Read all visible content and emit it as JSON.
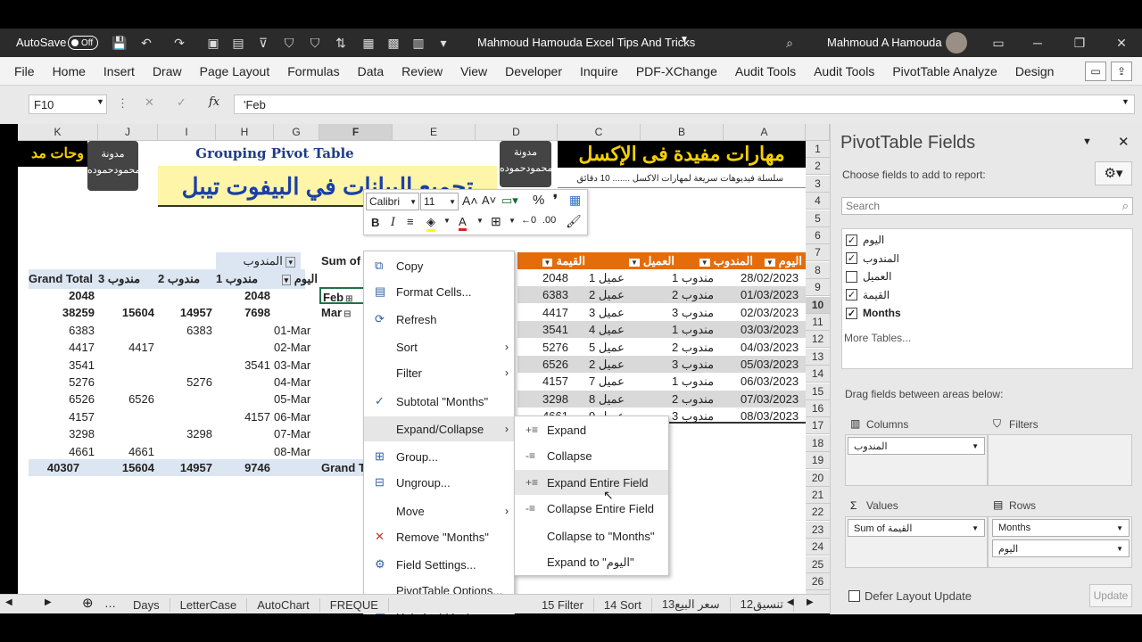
{
  "titlebar": {
    "autosave": "AutoSave",
    "toggle": "Off",
    "doc_title": "Mahmoud Hamouda Excel Tips And Tricks",
    "user": "Mahmoud A Hamouda"
  },
  "menu": [
    "File",
    "Home",
    "Insert",
    "Draw",
    "Page Layout",
    "Formulas",
    "Data",
    "Review",
    "View",
    "Developer",
    "Inquire",
    "PDF-XChange",
    "Audit Tools",
    "Audit Tools",
    "PivotTable Analyze",
    "Design"
  ],
  "formula": {
    "namebox": "F10",
    "cancel": "✕",
    "enter": "✓",
    "fx": "fx",
    "value": "'Feb"
  },
  "columns": [
    "K",
    "J",
    "I",
    "H",
    "G",
    "F",
    "E",
    "D",
    "C",
    "B",
    "A"
  ],
  "rows": [
    "1",
    "2",
    "3",
    "4",
    "5",
    "6",
    "7",
    "8",
    "9",
    "10",
    "11",
    "12",
    "13",
    "14",
    "15",
    "16",
    "17",
    "18",
    "19",
    "20",
    "21",
    "22",
    "23",
    "24",
    "25",
    "26",
    "27"
  ],
  "banner": {
    "left_top": "وحات مد",
    "logo1": "مدونة محمودحموده",
    "pivot_en": "Grouping Pivot Table",
    "pivot_ar": "تجميع البيانات في البيفوت تيبل",
    "logo2": "مدونة محمودحموده",
    "right_title": "مهارات مفيدة فى الإكسل",
    "right_sub": "سلسلة فيديوهات سريعة لمهارات الاكسل ....... 10 دقائق"
  },
  "pivot": {
    "sum_label": "Sum of",
    "col_field": "المندوب",
    "headers": [
      "Grand Total",
      "مندوب 3",
      "مندوب 2",
      "مندوب 1",
      "اليوم"
    ],
    "rows": [
      {
        "label": "",
        "gt": "2048",
        "m3": "",
        "m2": "",
        "m1": "2048",
        "bold": true,
        "f": "Feb"
      },
      {
        "label": "",
        "gt": "38259",
        "m3": "15604",
        "m2": "14957",
        "m1": "7698",
        "bold": true,
        "f": "Mar"
      },
      {
        "label": "01-Mar",
        "gt": "6383",
        "m3": "",
        "m2": "6383",
        "m1": "",
        "bold": false,
        "f": ""
      },
      {
        "label": "02-Mar",
        "gt": "4417",
        "m3": "4417",
        "m2": "",
        "m1": "",
        "bold": false,
        "f": ""
      },
      {
        "label": "03-Mar",
        "gt": "3541",
        "m3": "",
        "m2": "",
        "m1": "3541",
        "bold": false,
        "f": ""
      },
      {
        "label": "04-Mar",
        "gt": "5276",
        "m3": "",
        "m2": "5276",
        "m1": "",
        "bold": false,
        "f": ""
      },
      {
        "label": "05-Mar",
        "gt": "6526",
        "m3": "6526",
        "m2": "",
        "m1": "",
        "bold": false,
        "f": ""
      },
      {
        "label": "06-Mar",
        "gt": "4157",
        "m3": "",
        "m2": "",
        "m1": "4157",
        "bold": false,
        "f": ""
      },
      {
        "label": "07-Mar",
        "gt": "3298",
        "m3": "",
        "m2": "3298",
        "m1": "",
        "bold": false,
        "f": ""
      },
      {
        "label": "08-Mar",
        "gt": "4661",
        "m3": "4661",
        "m2": "",
        "m1": "",
        "bold": false,
        "f": ""
      }
    ],
    "total": {
      "gt": "40307",
      "m3": "15604",
      "m2": "14957",
      "m1": "9746",
      "label": "Grand T"
    },
    "mo_label": "Mo"
  },
  "table": {
    "headers": [
      "القيمة",
      "العميل",
      "المندوب",
      "اليوم"
    ],
    "rows": [
      [
        "2048",
        "عميل 1",
        "مندوب 1",
        "28/02/2023"
      ],
      [
        "6383",
        "عميل 2",
        "مندوب 2",
        "01/03/2023"
      ],
      [
        "4417",
        "عميل 3",
        "مندوب 3",
        "02/03/2023"
      ],
      [
        "3541",
        "عميل 4",
        "مندوب 1",
        "03/03/2023"
      ],
      [
        "5276",
        "عميل 5",
        "مندوب 2",
        "04/03/2023"
      ],
      [
        "6526",
        "عميل 2",
        "مندوب 3",
        "05/03/2023"
      ],
      [
        "4157",
        "عميل 7",
        "مندوب 1",
        "06/03/2023"
      ],
      [
        "3298",
        "عميل 8",
        "مندوب 2",
        "07/03/2023"
      ],
      [
        "4661",
        "عميل 9",
        "مندوب 3",
        "08/03/2023"
      ]
    ]
  },
  "mini_toolbar": {
    "font": "Calibri",
    "size": "11"
  },
  "context_menu": [
    {
      "label": "Copy",
      "icon": "copy-icon",
      "glyph": "⧉",
      "arrow": false
    },
    {
      "label": "Format Cells...",
      "icon": "format-cells-icon",
      "glyph": "▤",
      "arrow": false
    },
    {
      "label": "Refresh",
      "icon": "refresh-icon",
      "glyph": "⟳",
      "arrow": false
    },
    {
      "label": "Sort",
      "icon": "",
      "glyph": "",
      "arrow": true
    },
    {
      "label": "Filter",
      "icon": "",
      "glyph": "",
      "arrow": true
    },
    {
      "label": "Subtotal \"Months\"",
      "icon": "check-icon",
      "glyph": "✓",
      "arrow": false
    },
    {
      "label": "Expand/Collapse",
      "icon": "",
      "glyph": "",
      "arrow": true
    },
    {
      "label": "Group...",
      "icon": "group-icon",
      "glyph": "⊞",
      "arrow": false
    },
    {
      "label": "Ungroup...",
      "icon": "ungroup-icon",
      "glyph": "⊟",
      "arrow": false
    },
    {
      "label": "Move",
      "icon": "",
      "glyph": "",
      "arrow": true
    },
    {
      "label": "Remove \"Months\"",
      "icon": "remove-icon",
      "glyph": "✕",
      "arrow": false
    },
    {
      "label": "Field Settings...",
      "icon": "field-settings-icon",
      "glyph": "⚙",
      "arrow": false
    },
    {
      "label": "PivotTable Options...",
      "icon": "",
      "glyph": "",
      "arrow": false
    },
    {
      "label": "Hide Field List",
      "icon": "hide-field-list-icon",
      "glyph": "▦",
      "arrow": false
    }
  ],
  "submenu": [
    {
      "label": "Expand",
      "glyph": "+≡"
    },
    {
      "label": "Collapse",
      "glyph": "-≡"
    },
    {
      "label": "Expand Entire Field",
      "glyph": "+≡"
    },
    {
      "label": "Collapse Entire Field",
      "glyph": "-≡"
    },
    {
      "label": "Collapse to \"Months\"",
      "glyph": ""
    },
    {
      "label": "Expand to \"اليوم\"",
      "glyph": ""
    }
  ],
  "panel": {
    "title": "PivotTable Fields",
    "choose": "Choose fields to add to report:",
    "search_placeholder": "Search",
    "fields": [
      {
        "label": "اليوم",
        "checked": true,
        "bold": false
      },
      {
        "label": "المندوب",
        "checked": true,
        "bold": false
      },
      {
        "label": "العميل",
        "checked": false,
        "bold": false
      },
      {
        "label": "القيمة",
        "checked": true,
        "bold": false
      },
      {
        "label": "Months",
        "checked": true,
        "bold": true
      }
    ],
    "more_tables": "More Tables...",
    "drag": "Drag fields between areas below:",
    "columns_label": "Columns",
    "filters_label": "Filters",
    "values_label": "Values",
    "rows_label": "Rows",
    "columns_items": [
      "المندوب"
    ],
    "values_items": [
      "Sum of القيمة"
    ],
    "rows_items": [
      "Months",
      "اليوم"
    ],
    "defer": "Defer Layout Update",
    "update": "Update"
  },
  "tabs": [
    "Days",
    "LetterCase",
    "AutoChart",
    "FREQUE",
    "15 Filter",
    "14 Sort",
    "13سعر البيع",
    "12تنسيق"
  ]
}
